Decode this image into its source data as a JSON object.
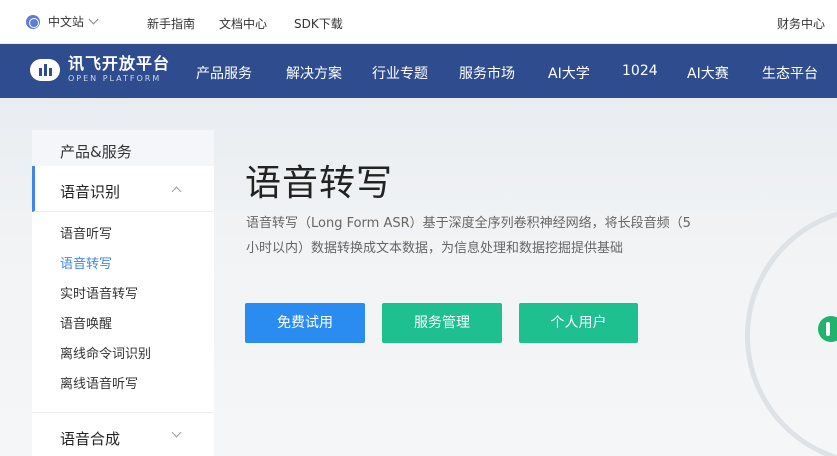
{
  "topbar": {
    "language": "中文站",
    "links": [
      "新手指南",
      "文档中心",
      "SDK下载"
    ],
    "finance": "财务中心"
  },
  "logo": {
    "cn": "讯飞开放平台",
    "en": "OPEN PLATFORM"
  },
  "nav": {
    "items": [
      "产品服务",
      "解决方案",
      "行业专题",
      "服务市场",
      "AI大学",
      "1024",
      "AI大赛",
      "生态平台"
    ]
  },
  "sidebar": {
    "heading": "产品&服务",
    "group1": "语音识别",
    "items": [
      "语音听写",
      "语音转写",
      "实时语音转写",
      "语音唤醒",
      "离线命令词识别",
      "离线语音听写"
    ],
    "current_index": 1,
    "group2": "语音合成"
  },
  "content": {
    "title": "语音转写",
    "description": "语音转写（Long Form ASR）基于深度全序列卷积神经网络，将长段音频（5小时以内）数据转换成文本数据，为信息处理和数据挖掘提供基础"
  },
  "buttons": {
    "trial": "免费试用",
    "manage": "服务管理",
    "personal": "个人用户"
  },
  "colors": {
    "nav_bg": "#2f4c8f",
    "accent_blue": "#3f86e6",
    "button_blue": "#2a8cf0",
    "button_green": "#1ec08f"
  },
  "icons": {
    "language": "globe-icon",
    "dropdown": "chevron-down-icon",
    "collapse": "chevron-up-icon",
    "logo": "cloud-waveform-logo"
  }
}
